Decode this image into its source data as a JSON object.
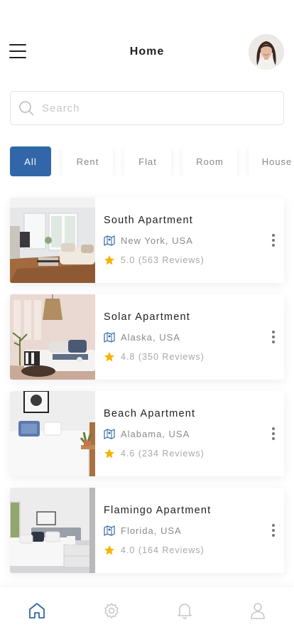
{
  "header": {
    "title": "Home",
    "menu_icon": "menu-icon",
    "avatar_icon": "user-avatar"
  },
  "search": {
    "placeholder": "Search",
    "value": "",
    "icon": "search-icon"
  },
  "filters": {
    "selected": "All",
    "items": [
      {
        "label": "All"
      },
      {
        "label": "Rent"
      },
      {
        "label": "Flat"
      },
      {
        "label": "Room"
      },
      {
        "label": "House"
      }
    ]
  },
  "listings": [
    {
      "name": "South Apartment",
      "location": "New York, USA",
      "rating": "5.0",
      "reviews": "(563 Reviews)"
    },
    {
      "name": "Solar Apartment",
      "location": "Alaska, USA",
      "rating": "4.8",
      "reviews": "(350 Reviews)"
    },
    {
      "name": "Beach Apartment",
      "location": "Alabama, USA",
      "rating": "4.6",
      "reviews": "(234 Reviews)"
    },
    {
      "name": "Flamingo Apartment",
      "location": "Florida, USA",
      "rating": "4.0",
      "reviews": "(164 Reviews)"
    }
  ],
  "bottom_nav": {
    "active": "home",
    "items": [
      {
        "key": "home",
        "icon": "home-icon"
      },
      {
        "key": "settings",
        "icon": "gear-icon"
      },
      {
        "key": "notifications",
        "icon": "bell-icon"
      },
      {
        "key": "profile",
        "icon": "user-icon"
      }
    ]
  },
  "colors": {
    "accent": "#3167a8",
    "star": "#f4b400",
    "text_muted": "#8a8a8a"
  }
}
